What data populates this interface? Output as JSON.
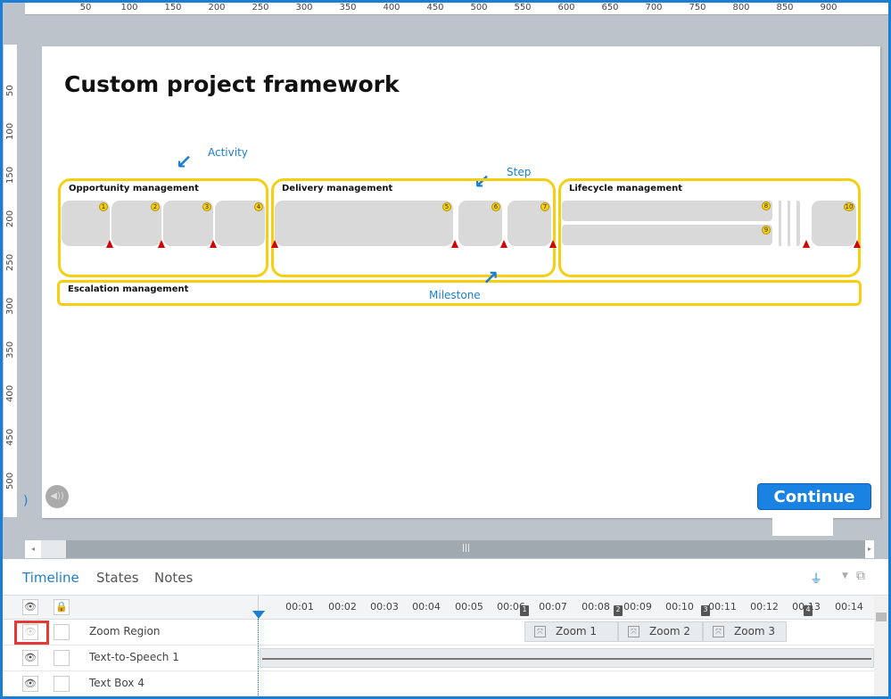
{
  "ruler": {
    "top": [
      "50",
      "100",
      "150",
      "200",
      "250",
      "300",
      "350",
      "400",
      "450",
      "500",
      "550",
      "600",
      "650",
      "700",
      "750",
      "800",
      "850",
      "900"
    ],
    "left": [
      "50",
      "100",
      "150",
      "200",
      "250",
      "300",
      "350",
      "400",
      "450",
      "500"
    ]
  },
  "slide": {
    "title": "Custom project framework",
    "groups": [
      {
        "label": "Opportunity management"
      },
      {
        "label": "Delivery management"
      },
      {
        "label": "Lifecycle management"
      },
      {
        "label": "Escalation management"
      }
    ],
    "step_numbers": [
      "1",
      "2",
      "3",
      "4",
      "5",
      "6",
      "7",
      "8",
      "9",
      "10"
    ],
    "callouts": {
      "activity": "Activity",
      "step": "Step",
      "milestone": "Milestone"
    },
    "continue_label": "Continue",
    "audio_icon": "speaker-icon"
  },
  "panel": {
    "tabs": [
      "Timeline",
      "States",
      "Notes"
    ],
    "active_tab": "Timeline",
    "times": [
      "00:01",
      "00:02",
      "00:03",
      "00:04",
      "00:05",
      "00:06",
      "00:07",
      "00:08",
      "00:09",
      "00:10",
      "00:11",
      "00:12",
      "00:13",
      "00:14"
    ],
    "markers": [
      "1",
      "2",
      "3",
      "4"
    ],
    "rows": [
      {
        "label": "Zoom Region"
      },
      {
        "label": "Text-to-Speech 1"
      },
      {
        "label": "Text Box 4"
      }
    ],
    "zooms": [
      "Zoom 1",
      "Zoom 2",
      "Zoom 3"
    ]
  },
  "colors": {
    "accent": "#1a7fd4",
    "group_border": "#f5cf10",
    "milestone": "#d40000",
    "highlight": "#e53935"
  }
}
